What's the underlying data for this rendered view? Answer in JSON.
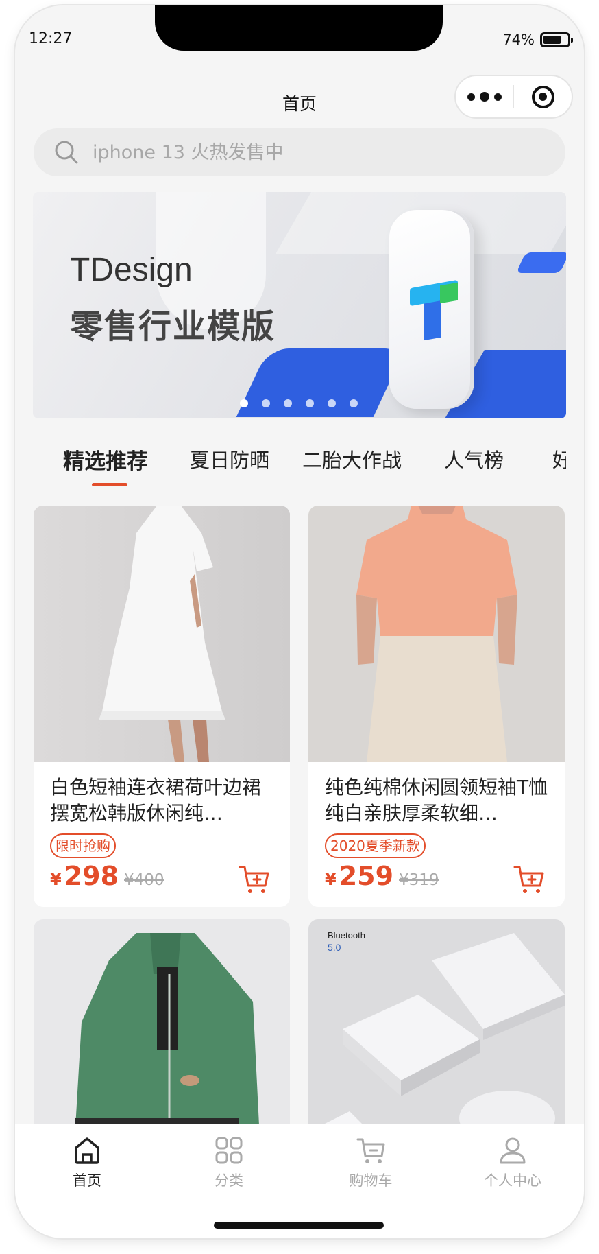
{
  "status_bar": {
    "time": "12:27",
    "battery": "74%",
    "battery_level": 0.74
  },
  "nav": {
    "title": "首页",
    "more_icon": "more-dots-icon",
    "close_icon": "target-icon"
  },
  "search": {
    "placeholder": "iphone 13 火热发售中",
    "icon": "search-icon"
  },
  "banner": {
    "title_line1": "TDesign",
    "title_line2": "零售行业模版",
    "slide_count": 6,
    "active_slide": 1
  },
  "tabs": [
    {
      "label": "精选推荐",
      "active": true
    },
    {
      "label": "夏日防晒",
      "active": false
    },
    {
      "label": "二胎大作战",
      "active": false
    },
    {
      "label": "人气榜",
      "active": false
    },
    {
      "label": "好",
      "active": false
    }
  ],
  "products": [
    {
      "title": "白色短袖连衣裙荷叶边裙摆宽松韩版休闲纯…",
      "tag": "限时抢购",
      "currency": "¥",
      "price": "298",
      "original_price": "¥400",
      "image": "white-dress-photo"
    },
    {
      "title": "纯色纯棉休闲圆领短袖T恤纯白亲肤厚柔软细…",
      "tag": "2020夏季新款",
      "currency": "¥",
      "price": "259",
      "original_price": "¥319",
      "image": "peach-tshirt-photo"
    },
    {
      "title": "",
      "tag": "",
      "currency": "",
      "price": "",
      "original_price": "",
      "image": "green-hoodie-photo"
    },
    {
      "title": "",
      "tag": "",
      "currency": "",
      "price": "",
      "original_price": "",
      "image": "router-photo",
      "image_text": "Bluetooth",
      "image_subtext": "5.0"
    }
  ],
  "tabbar": [
    {
      "label": "首页",
      "icon": "home-icon",
      "active": true
    },
    {
      "label": "分类",
      "icon": "category-grid-icon",
      "active": false
    },
    {
      "label": "购物车",
      "icon": "cart-icon",
      "active": false
    },
    {
      "label": "个人中心",
      "icon": "user-icon",
      "active": false
    }
  ],
  "colors": {
    "accent": "#e34d2a",
    "background": "#f5f5f5",
    "banner_blue": "#2f5fe0"
  }
}
